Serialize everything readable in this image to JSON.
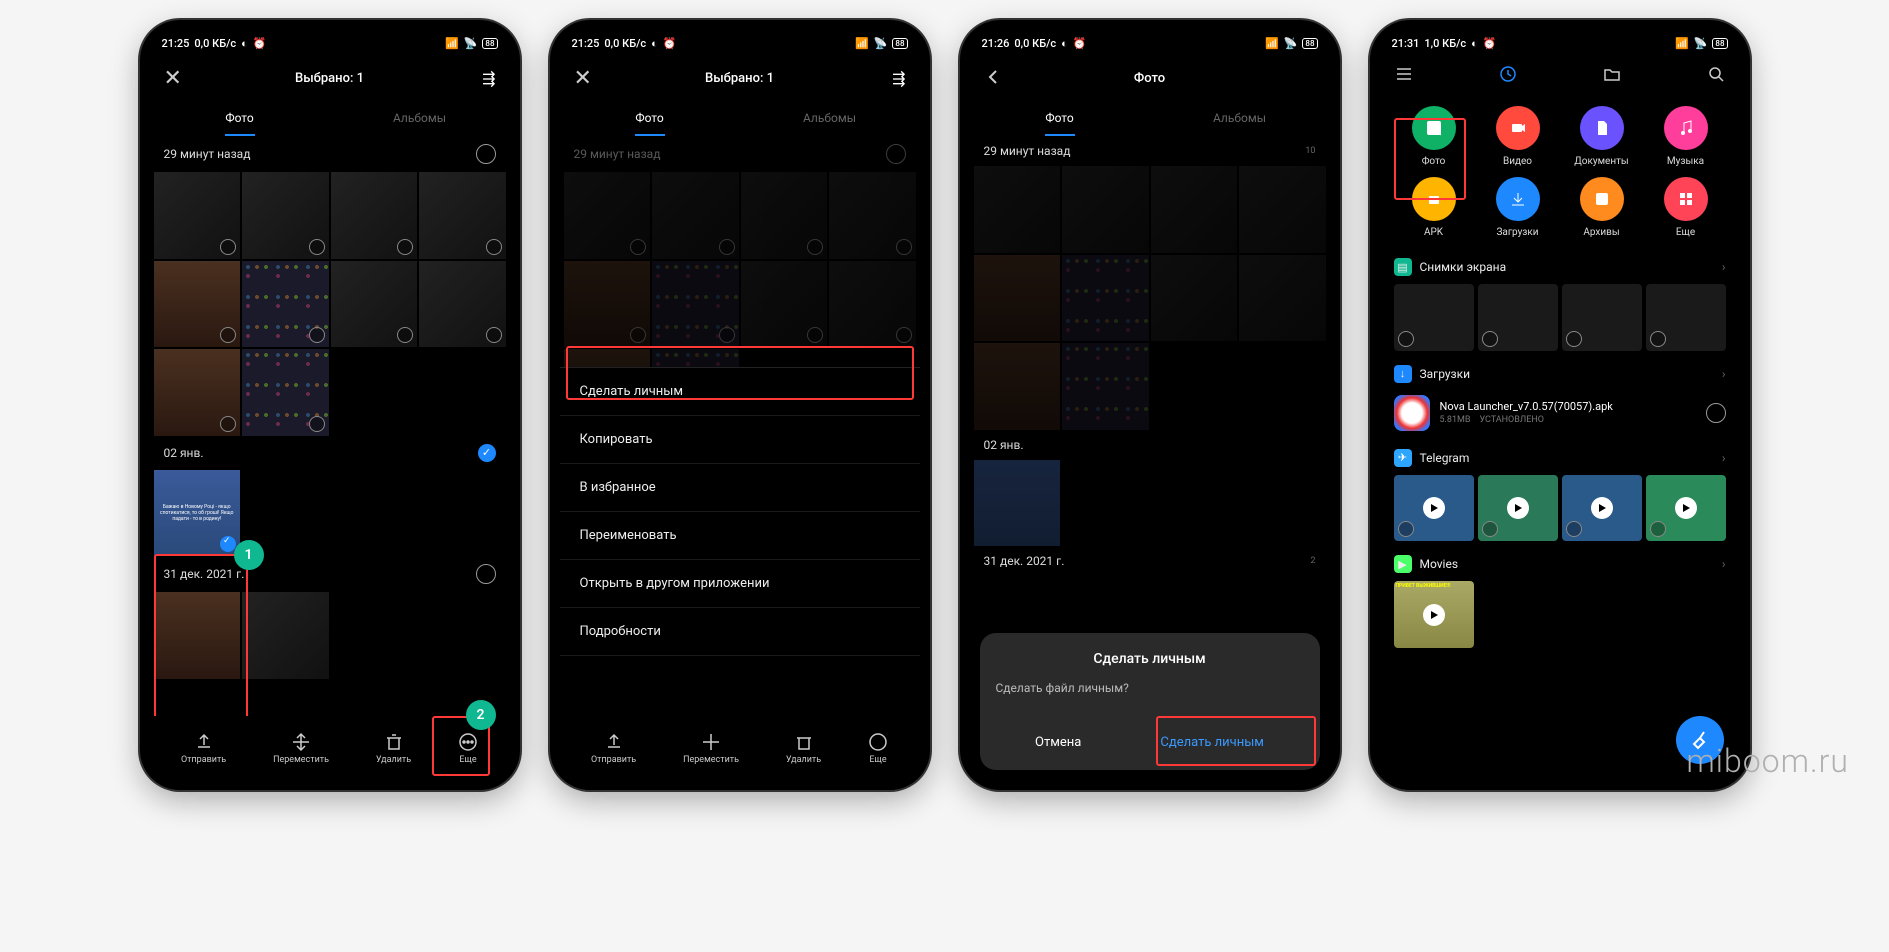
{
  "watermark": "miboom.ru",
  "screens": [
    {
      "status": {
        "time": "21:25",
        "speed": "0,0 КБ/с",
        "battery": "88"
      },
      "title": "Выбрано: 1",
      "tabs": {
        "photos": "Фото",
        "albums": "Альбомы"
      },
      "sections": [
        {
          "label": "29 минут назад"
        },
        {
          "label": "02 янв."
        },
        {
          "label": "31 дек. 2021 г."
        }
      ],
      "selected_text": "Бажаю в Новому Році - якщо спотикатися, то об гроші! Якщо падати - то в родину!",
      "bottombar": {
        "send": "Отправить",
        "move": "Переместить",
        "delete": "Удалить",
        "more": "Еще"
      },
      "badges": {
        "one": "1",
        "two": "2"
      }
    },
    {
      "status": {
        "time": "21:25",
        "speed": "0,0 КБ/с",
        "battery": "88"
      },
      "title": "Выбрано: 1",
      "tabs": {
        "photos": "Фото",
        "albums": "Альбомы"
      },
      "sections": [
        {
          "label": "29 минут назад"
        }
      ],
      "menu": {
        "make_private": "Сделать личным",
        "copy": "Копировать",
        "favorite": "В избранное",
        "rename": "Переименовать",
        "open_with": "Открыть в другом приложении",
        "details": "Подробности"
      },
      "bottombar": {
        "send": "Отправить",
        "move": "Переместить",
        "delete": "Удалить",
        "more": "Еще"
      }
    },
    {
      "status": {
        "time": "21:26",
        "speed": "0,0 КБ/с",
        "battery": "88"
      },
      "title": "Фото",
      "tabs": {
        "photos": "Фото",
        "albums": "Альбомы"
      },
      "sections": [
        {
          "label": "29 минут назад",
          "count": "10"
        },
        {
          "label": "02 янв."
        },
        {
          "label": "31 дек. 2021 г.",
          "count": "2"
        }
      ],
      "dialog": {
        "title": "Сделать личным",
        "message": "Сделать файл личным?",
        "cancel": "Отмена",
        "confirm": "Сделать личным"
      }
    },
    {
      "status": {
        "time": "21:31",
        "speed": "1,0 КБ/с",
        "battery": "88"
      },
      "cats": {
        "photo": "Фото",
        "video": "Видео",
        "docs": "Документы",
        "music": "Музыка",
        "apk": "APK",
        "downloads": "Загрузки",
        "archives": "Архивы",
        "more": "Еще"
      },
      "cat_colors": {
        "photo": "#0fb167",
        "video": "#ff4a3d",
        "docs": "#6a52ff",
        "music": "#ff3d9a",
        "apk": "#ffb400",
        "downloads": "#1e88ff",
        "archives": "#ff8a1e",
        "more": "#ff4458"
      },
      "sections": {
        "screenshots": "Снимки экрана",
        "downloads": "Загрузки",
        "file": {
          "name": "Nova Launcher_v7.0.57(70057).apk",
          "size": "5.81MB",
          "status": "УСТАНОВЛЕНО"
        },
        "telegram": "Telegram",
        "movies": "Movies",
        "movie_thumb": "ПРИВЕТ ВЫЖИВШИЕ!!!"
      }
    }
  ]
}
